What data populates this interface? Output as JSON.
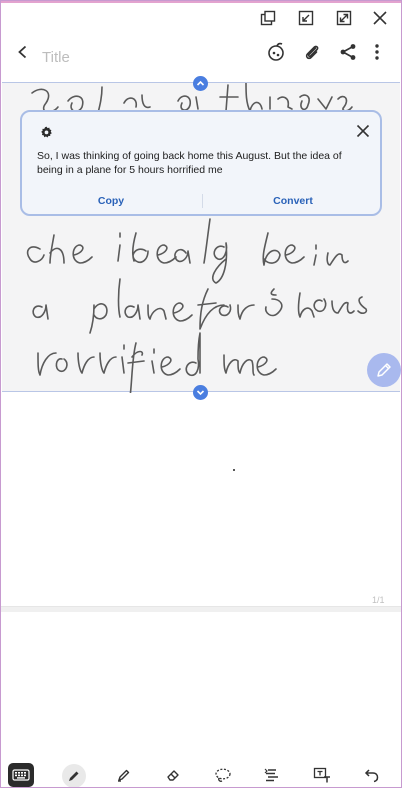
{
  "header": {
    "title_placeholder": "Title"
  },
  "popup": {
    "recognized_text": "So, I was thinking of going back home this August. But the idea of being in a plane for 5 hours horrified me",
    "copy_label": "Copy",
    "convert_label": "Convert"
  },
  "page": {
    "indicator": "1/1"
  },
  "colors": {
    "accent": "#4a7ee0",
    "action_text": "#2a62b8",
    "popup_border": "#a9bde6",
    "ink": "#555555"
  },
  "icons": {
    "window": [
      "pop-out-icon",
      "minimize-icon",
      "maximize-icon",
      "close-icon"
    ],
    "header": [
      "back-icon",
      "color-palette-icon",
      "attach-icon",
      "share-icon",
      "more-icon"
    ],
    "toolbar": [
      "keyboard-icon",
      "pen-icon",
      "highlighter-icon",
      "eraser-icon",
      "lasso-icon",
      "text-style-icon",
      "text-box-icon",
      "undo-icon"
    ]
  }
}
